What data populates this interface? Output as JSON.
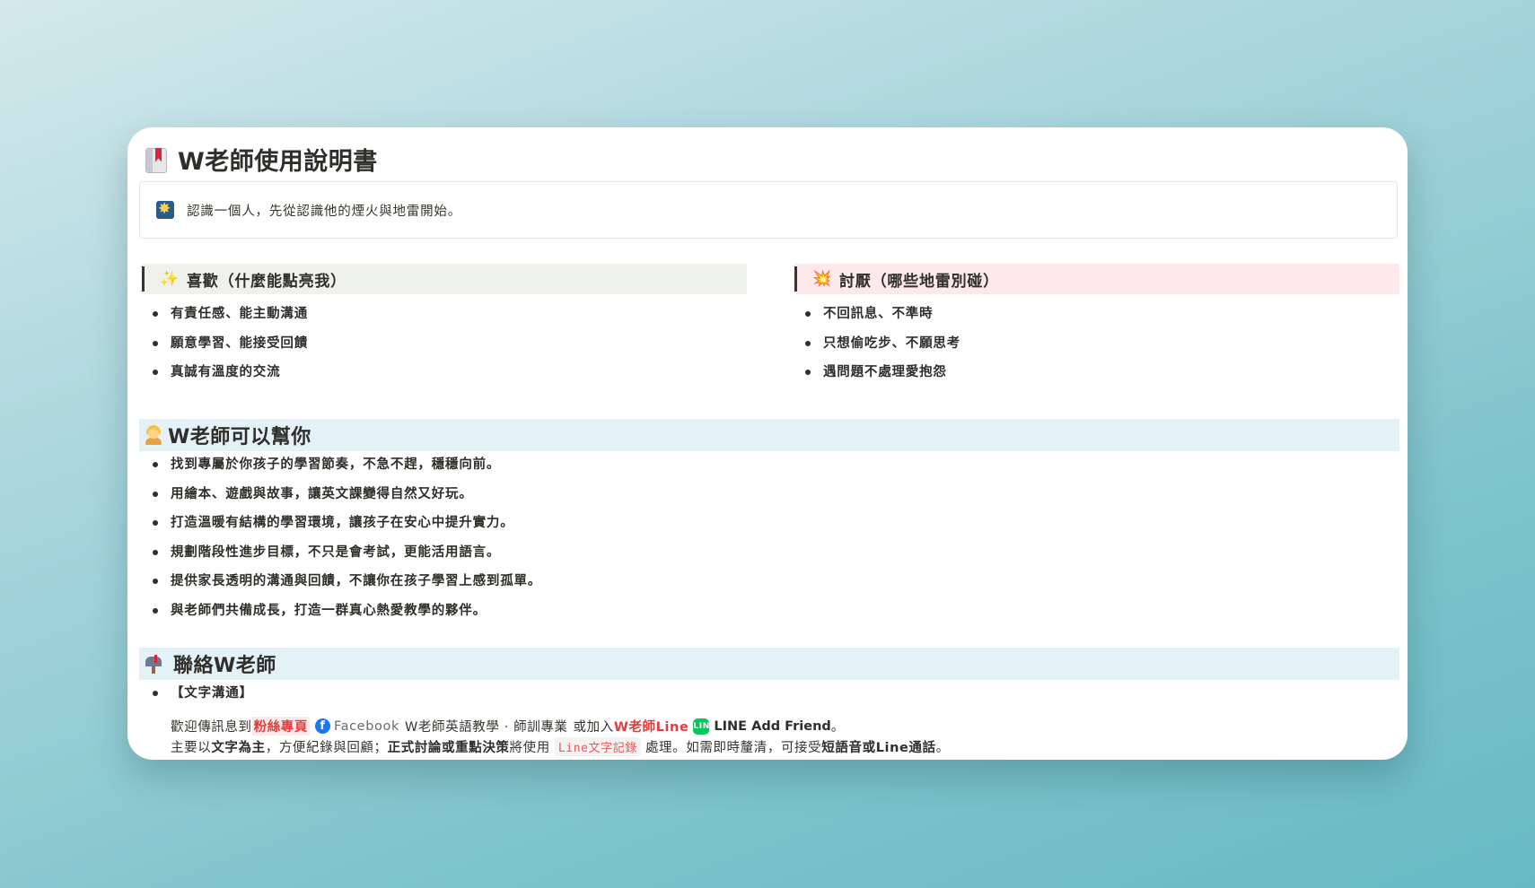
{
  "page": {
    "title": "W老師使用說明書",
    "title_icon": "book-with-bookmark-icon",
    "callout": {
      "icon": "fireworks-icon",
      "text": "認識一個人，先從認識他的煙火與地雷開始。"
    }
  },
  "likes": {
    "heading_emoji": "✨",
    "heading": "喜歡（什麼能點亮我）",
    "heading_bg": "#eff2ec",
    "items": [
      "有責任感、能主動溝通",
      "願意學習、能接受回饋",
      "真誠有溫度的交流"
    ]
  },
  "dislikes": {
    "heading_emoji": "💥",
    "heading": "討厭（哪些地雷別碰）",
    "heading_bg": "#fde9ec",
    "items": [
      "不回訊息、不準時",
      "只想偷吃步、不願思考",
      "遇問題不處理愛抱怨"
    ]
  },
  "help": {
    "heading": "W老師可以幫你",
    "heading_icon": "person-icon",
    "items": [
      {
        "pre": "找到",
        "bold": "專屬於你孩子的學習節奏",
        "post": "，不急不趕，穩穩向前。"
      },
      {
        "pre": "用",
        "bold": "繪本、遊戲與故事",
        "post": "，讓英文課變得自然又好玩。"
      },
      {
        "pre": "打造",
        "bold": "溫暖有結構的學習環境",
        "post": "，讓孩子在安心中提升實力。"
      },
      {
        "pre": "規劃",
        "bold": "階段性進步目標",
        "post": "，不只是會考試，更能活用語言。"
      },
      {
        "pre": "提供家長",
        "bold": "透明的溝通與回饋",
        "post": "，不讓你在孩子學習上感到孤單。"
      },
      {
        "pre": "與老師們共備成長，",
        "bold": "打造一群真心熱愛教學的夥伴",
        "post": "。"
      }
    ]
  },
  "contact": {
    "heading": "聯絡W老師",
    "heading_icon": "mailbox-icon",
    "item_label": "【文字溝通】",
    "line1": {
      "pre": "歡迎傳訊息到",
      "fan_page": "粉絲專頁",
      "fb_link": "Facebook",
      "fb_name": "W老師英語教學 · 師訓專業",
      "mid": "或加入",
      "line_label": "W老師Line",
      "line_link": "LINE Add Friend",
      "end": "。"
    },
    "line2": {
      "pre": "主要以",
      "bold1": "文字為主",
      "mid1": "，方便紀錄與回顧；",
      "bold2": "正式討論或重點決策",
      "mid2": "將使用",
      "code": "Line文字記錄",
      "mid3": "處理。如需即時釐清，可接受",
      "bold3": "短語音或Line通話",
      "end": "。"
    }
  }
}
